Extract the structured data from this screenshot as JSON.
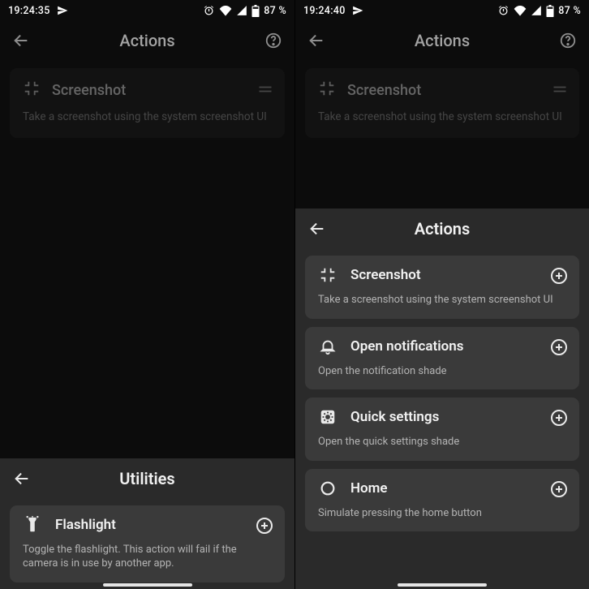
{
  "left": {
    "statusbar": {
      "time": "19:24:35",
      "battery": "87 %"
    },
    "appbar": {
      "title": "Actions"
    },
    "dim_card": {
      "title": "Screenshot",
      "desc": "Take a screenshot using the system screenshot UI"
    },
    "sheet": {
      "title": "Utilities",
      "cards": [
        {
          "title": "Flashlight",
          "desc": "Toggle the flashlight. This action will fail if the camera is in use by another app."
        }
      ]
    }
  },
  "right": {
    "statusbar": {
      "time": "19:24:40",
      "battery": "87 %"
    },
    "appbar": {
      "title": "Actions"
    },
    "dim_card": {
      "title": "Screenshot",
      "desc": "Take a screenshot using the system screenshot UI"
    },
    "sheet": {
      "title": "Actions",
      "cards": [
        {
          "title": "Screenshot",
          "desc": "Take a screenshot using the system screenshot UI"
        },
        {
          "title": "Open notifications",
          "desc": "Open the notification shade"
        },
        {
          "title": "Quick settings",
          "desc": "Open the quick settings shade"
        },
        {
          "title": "Home",
          "desc": "Simulate pressing the home button"
        }
      ]
    }
  }
}
